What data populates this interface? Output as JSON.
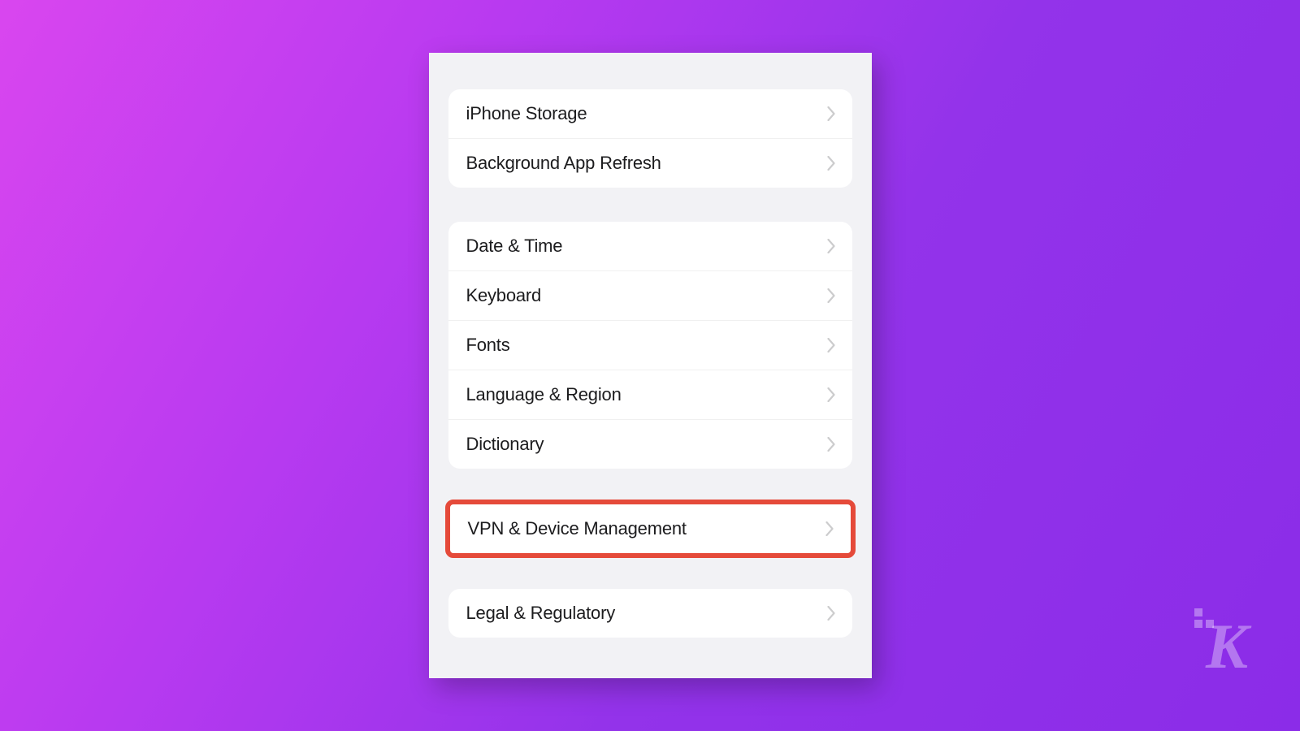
{
  "groups": [
    {
      "id": "storage-group",
      "highlighted": false,
      "items": [
        {
          "id": "row-iphone-storage",
          "label": "iPhone Storage"
        },
        {
          "id": "row-background-app-refresh",
          "label": "Background App Refresh"
        }
      ]
    },
    {
      "id": "locale-group",
      "highlighted": false,
      "items": [
        {
          "id": "row-date-time",
          "label": "Date & Time"
        },
        {
          "id": "row-keyboard",
          "label": "Keyboard"
        },
        {
          "id": "row-fonts",
          "label": "Fonts"
        },
        {
          "id": "row-language-region",
          "label": "Language & Region"
        },
        {
          "id": "row-dictionary",
          "label": "Dictionary"
        }
      ]
    },
    {
      "id": "vpn-group",
      "highlighted": true,
      "items": [
        {
          "id": "row-vpn-device-management",
          "label": "VPN & Device Management"
        }
      ]
    },
    {
      "id": "legal-group",
      "highlighted": false,
      "items": [
        {
          "id": "row-legal-regulatory",
          "label": "Legal & Regulatory"
        }
      ]
    }
  ],
  "watermark": "K"
}
